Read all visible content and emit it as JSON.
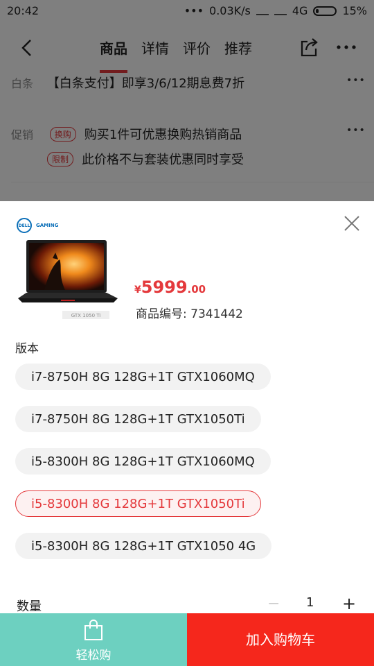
{
  "status_bar": {
    "time": "20:42",
    "network_speed": "0.03K/s",
    "network_type": "4G",
    "battery": "15%"
  },
  "nav": {
    "tabs": [
      "商品",
      "详情",
      "评价",
      "推荐"
    ],
    "active_tab": 0
  },
  "baitiao": {
    "label": "白条",
    "text": "【白条支付】即享3/6/12期息费7折"
  },
  "promo": {
    "label": "促销",
    "items": [
      {
        "tag": "换购",
        "text": "购买1件可优惠换购热销商品"
      },
      {
        "tag": "限制",
        "text": "此价格不与套装优惠同时享受"
      }
    ]
  },
  "sheet": {
    "brand_logo": "DELL",
    "brand_sub": "GAMING",
    "product_badge": "GTX 1050 Ti",
    "price_symbol": "¥",
    "price_int": "5999",
    "price_dec": ".00",
    "sku": "商品编号: 7341442",
    "version_title": "版本",
    "options": [
      "i7-8750H 8G 128G+1T GTX1060MQ",
      "i7-8750H 8G 128G+1T GTX1050Ti",
      "i5-8300H 8G 128G+1T GTX1060MQ",
      "i5-8300H 8G 128G+1T GTX1050Ti",
      "i5-8300H 8G 128G+1T GTX1050 4G"
    ],
    "selected_option": 3,
    "quantity_label": "数量",
    "quantity": "1",
    "minus": "−",
    "plus": "+"
  },
  "bottom": {
    "easy_buy": "轻松购",
    "add_to_cart": "加入购物车"
  },
  "colors": {
    "accent": "#e4393c",
    "easy_buy_bg": "#6dd0c0",
    "cart_bg": "#f5271c"
  }
}
